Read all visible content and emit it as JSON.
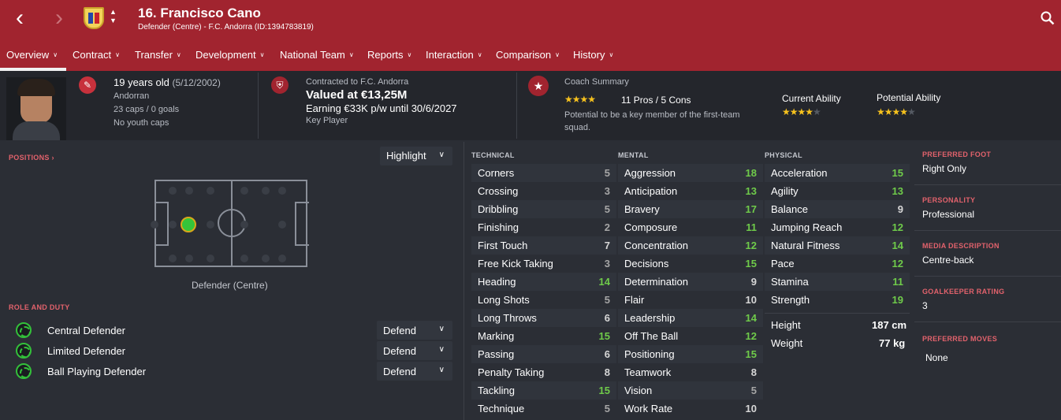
{
  "header": {
    "name": "16. Francisco Cano",
    "subtitle": "Defender (Centre) - F.C. Andorra (ID:1394783819)"
  },
  "tabs": [
    {
      "label": "Overview"
    },
    {
      "label": "Contract"
    },
    {
      "label": "Transfer"
    },
    {
      "label": "Development"
    },
    {
      "label": "National Team"
    },
    {
      "label": "Reports"
    },
    {
      "label": "Interaction"
    },
    {
      "label": "Comparison"
    },
    {
      "label": "History"
    }
  ],
  "personal": {
    "age": "19 years old",
    "dob": "(5/12/2002)",
    "nationality": "Andorran",
    "caps": "23 caps / 0 goals",
    "youth": "No youth caps"
  },
  "contract": {
    "club_line": "Contracted to F.C. Andorra",
    "value": "Valued at €13,25M",
    "earning": "Earning €33K p/w until 30/6/2027",
    "status": "Key Player"
  },
  "coach": {
    "title": "Coach Summary",
    "stars": 4,
    "pros_cons": "11 Pros / 5 Cons",
    "summary_line1": "Potential to be a key member of the first-team",
    "summary_line2": "squad.",
    "current_ability_label": "Current Ability",
    "current_ability_stars": 4,
    "potential_ability_label": "Potential Ability",
    "potential_ability_stars": 4
  },
  "positions": {
    "label": "POSITIONS",
    "highlight_label": "Highlight",
    "position_name": "Defender (Centre)"
  },
  "roles": {
    "label": "ROLE AND DUTY",
    "items": [
      {
        "role": "Central Defender",
        "duty": "Defend"
      },
      {
        "role": "Limited Defender",
        "duty": "Defend"
      },
      {
        "role": "Ball Playing Defender",
        "duty": "Defend"
      }
    ]
  },
  "technical": {
    "label": "TECHNICAL",
    "items": [
      {
        "name": "Corners",
        "value": "5"
      },
      {
        "name": "Crossing",
        "value": "3"
      },
      {
        "name": "Dribbling",
        "value": "5"
      },
      {
        "name": "Finishing",
        "value": "2"
      },
      {
        "name": "First Touch",
        "value": "7"
      },
      {
        "name": "Free Kick Taking",
        "value": "3"
      },
      {
        "name": "Heading",
        "value": "14"
      },
      {
        "name": "Long Shots",
        "value": "5"
      },
      {
        "name": "Long Throws",
        "value": "6"
      },
      {
        "name": "Marking",
        "value": "15"
      },
      {
        "name": "Passing",
        "value": "6"
      },
      {
        "name": "Penalty Taking",
        "value": "8"
      },
      {
        "name": "Tackling",
        "value": "15"
      },
      {
        "name": "Technique",
        "value": "5"
      }
    ]
  },
  "mental": {
    "label": "MENTAL",
    "items": [
      {
        "name": "Aggression",
        "value": "18"
      },
      {
        "name": "Anticipation",
        "value": "13"
      },
      {
        "name": "Bravery",
        "value": "17"
      },
      {
        "name": "Composure",
        "value": "11"
      },
      {
        "name": "Concentration",
        "value": "12"
      },
      {
        "name": "Decisions",
        "value": "15"
      },
      {
        "name": "Determination",
        "value": "9"
      },
      {
        "name": "Flair",
        "value": "10"
      },
      {
        "name": "Leadership",
        "value": "14"
      },
      {
        "name": "Off The Ball",
        "value": "12"
      },
      {
        "name": "Positioning",
        "value": "15"
      },
      {
        "name": "Teamwork",
        "value": "8"
      },
      {
        "name": "Vision",
        "value": "5"
      },
      {
        "name": "Work Rate",
        "value": "10"
      }
    ]
  },
  "physical": {
    "label": "PHYSICAL",
    "items": [
      {
        "name": "Acceleration",
        "value": "15"
      },
      {
        "name": "Agility",
        "value": "13"
      },
      {
        "name": "Balance",
        "value": "9"
      },
      {
        "name": "Jumping Reach",
        "value": "12"
      },
      {
        "name": "Natural Fitness",
        "value": "14"
      },
      {
        "name": "Pace",
        "value": "12"
      },
      {
        "name": "Stamina",
        "value": "11"
      },
      {
        "name": "Strength",
        "value": "19"
      }
    ],
    "height_label": "Height",
    "height": "187 cm",
    "weight_label": "Weight",
    "weight": "77 kg"
  },
  "side": {
    "foot_label": "PREFERRED FOOT",
    "foot": "Right Only",
    "personality_label": "PERSONALITY",
    "personality": "Professional",
    "media_label": "MEDIA DESCRIPTION",
    "media": "Centre-back",
    "gk_label": "GOALKEEPER RATING",
    "gk": "3",
    "moves_label": "PREFERRED MOVES",
    "moves": "None"
  },
  "colors": {
    "header": "#a1242f",
    "background": "#2b2e35",
    "accent_label": "#e2626c",
    "good_value": "#6fcb4a",
    "star": "#f7c21e"
  }
}
